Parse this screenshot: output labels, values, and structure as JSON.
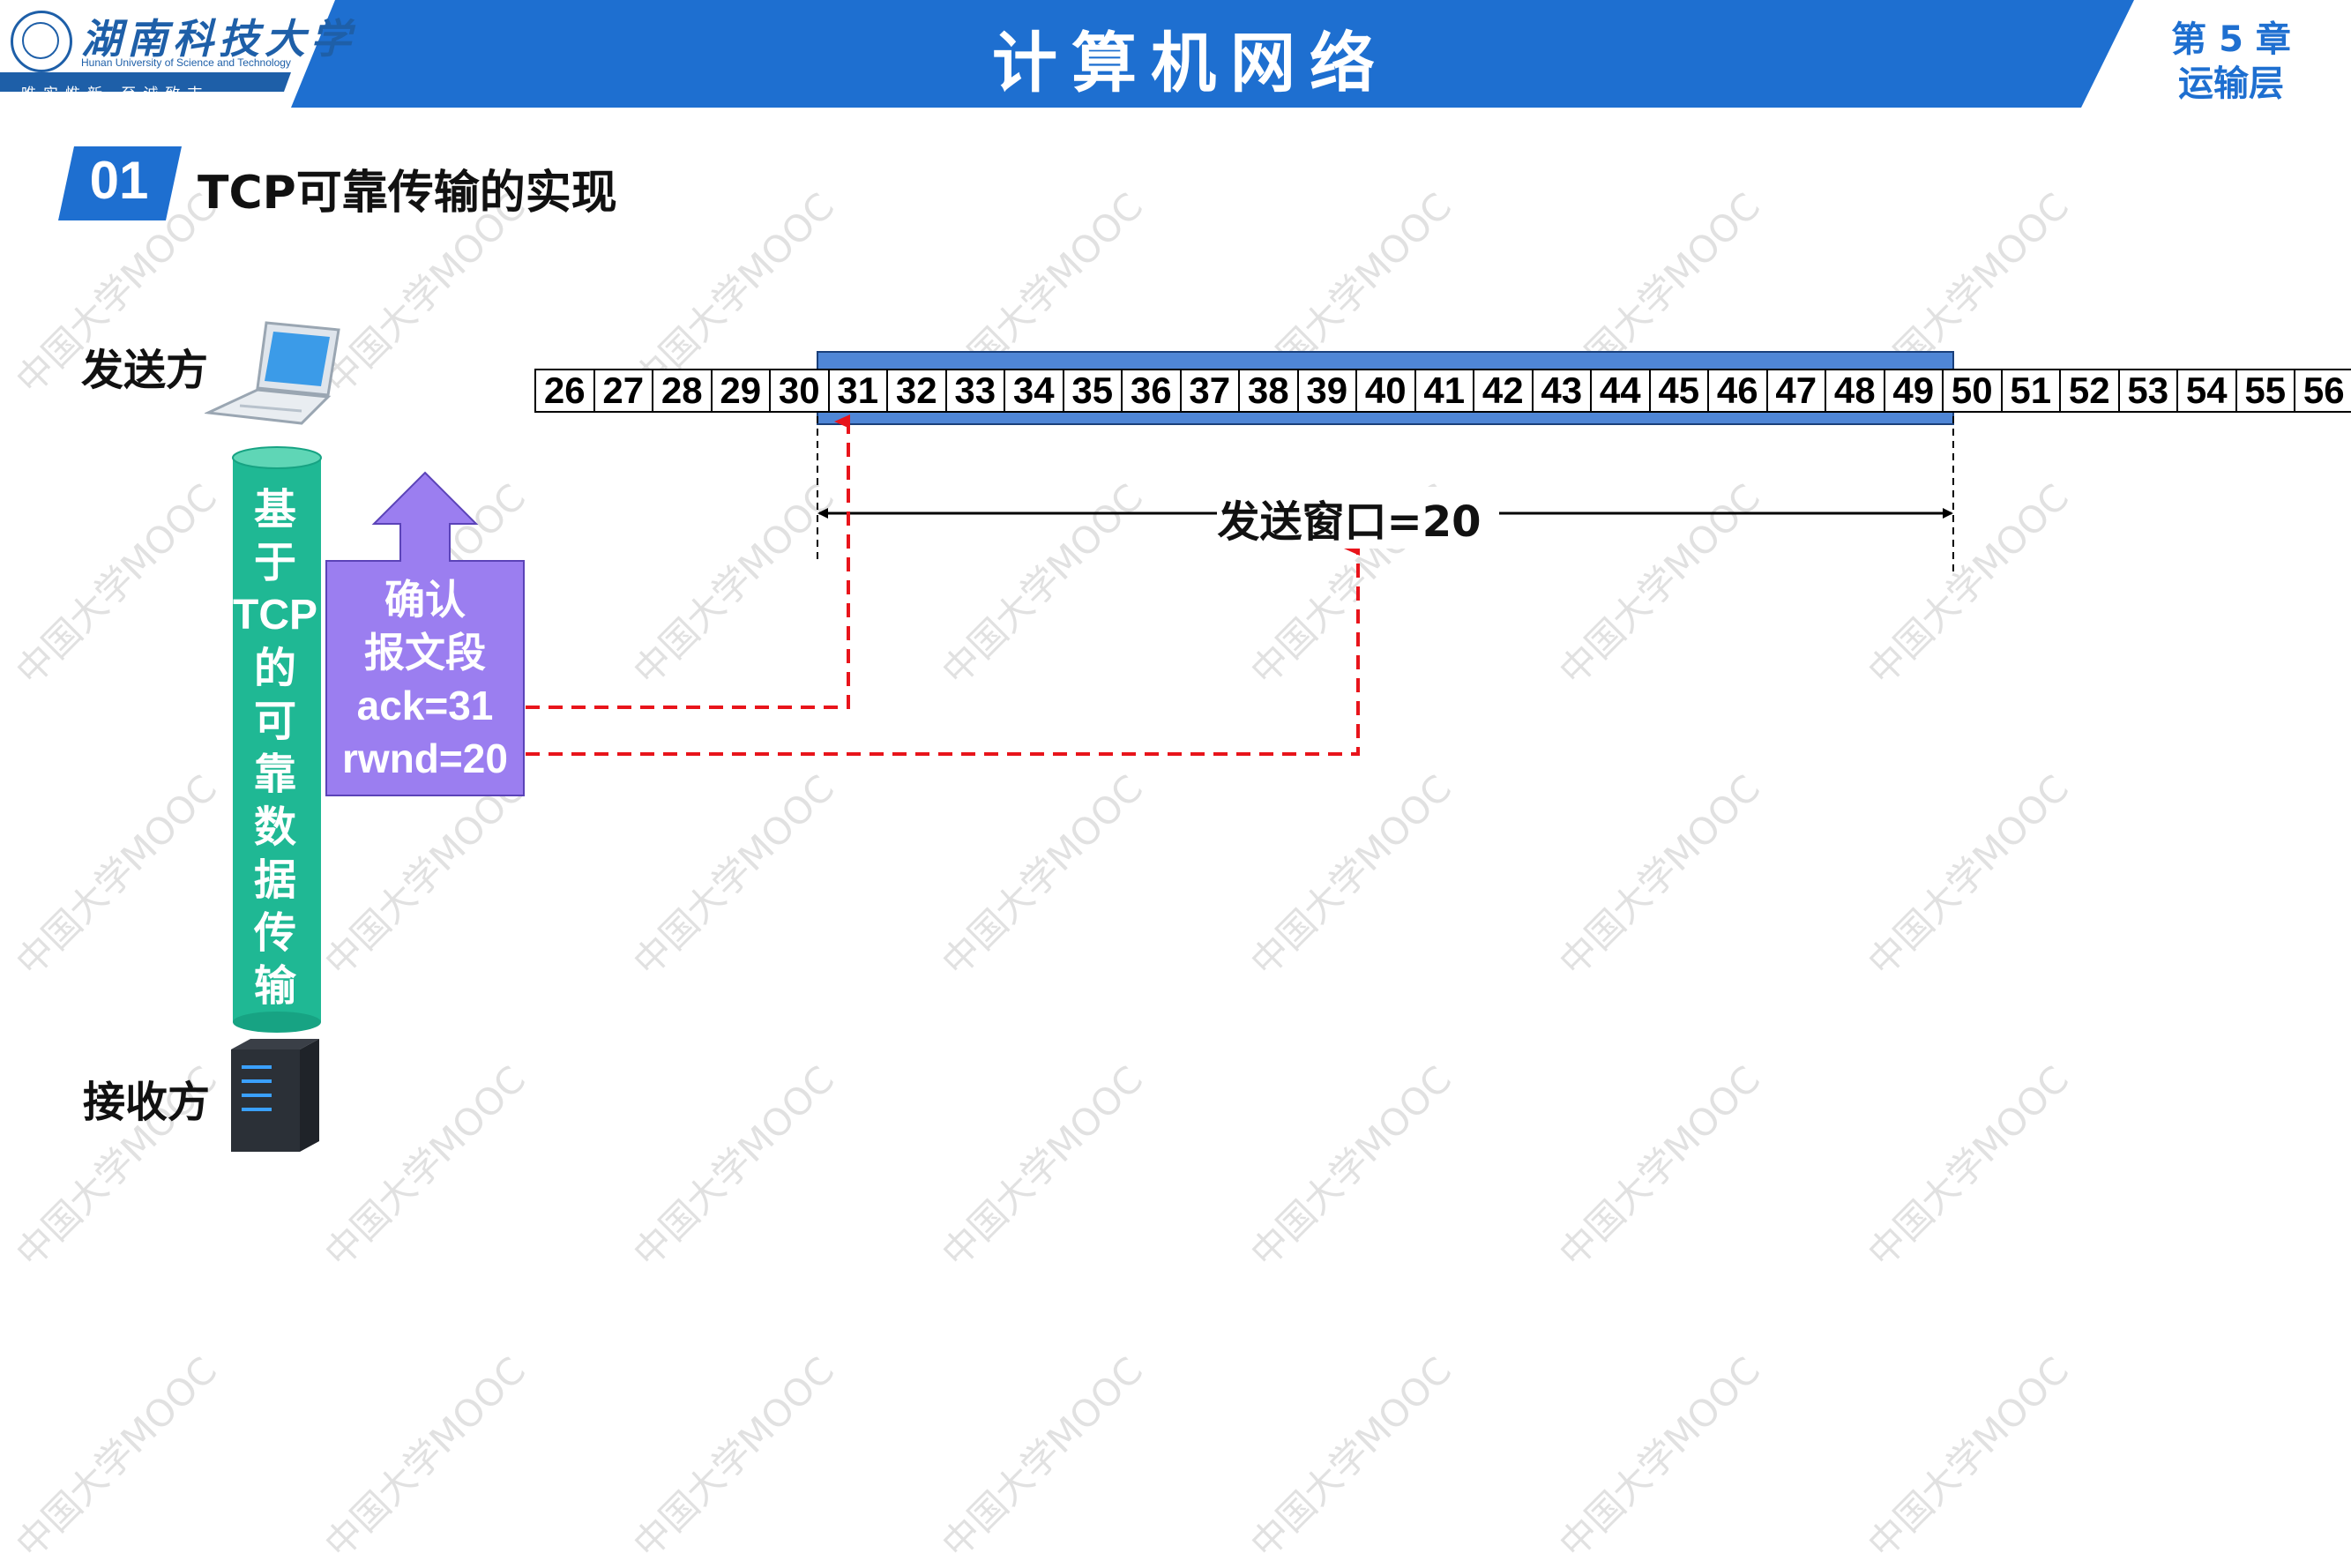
{
  "header": {
    "logo_cn": "湖南科技大学",
    "logo_en": "Hunan University of Science and Technology",
    "logo_motto": "唯实惟新  至诚致志",
    "title": "计算机网络",
    "chapter_num": "第 5 章",
    "chapter_name": "运输层"
  },
  "section": {
    "number": "01",
    "title": "TCP可靠传输的实现"
  },
  "diagram": {
    "sender_label": "发送方",
    "receiver_label": "接收方",
    "channel_lines": [
      "基",
      "于",
      "TCP",
      "的",
      "可",
      "靠",
      "数",
      "据",
      "传",
      "输"
    ],
    "ack_lines": [
      "确认",
      "报文段",
      "ack=31",
      "rwnd=20"
    ],
    "sequence_numbers": [
      "26",
      "27",
      "28",
      "29",
      "30",
      "31",
      "32",
      "33",
      "34",
      "35",
      "36",
      "37",
      "38",
      "39",
      "40",
      "41",
      "42",
      "43",
      "44",
      "45",
      "46",
      "47",
      "48",
      "49",
      "50",
      "51",
      "52",
      "53",
      "54",
      "55",
      "56"
    ],
    "window_start": 31,
    "window_end": 50,
    "window_label": "发送窗口=20"
  },
  "watermark": "中国大学MOOC",
  "colors": {
    "header_blue": "#1e6fd0",
    "window_blue": "#4f86d6",
    "channel_green": "#1fb894",
    "ack_purple": "#9b7ef0",
    "arrow_red": "#e8141b"
  }
}
